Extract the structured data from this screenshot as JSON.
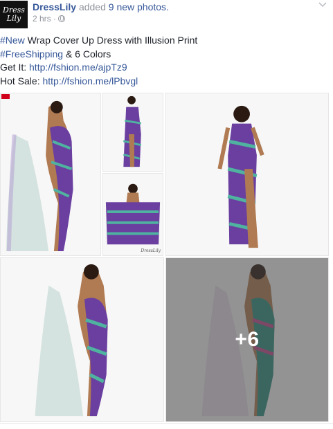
{
  "page": {
    "avatar_text": [
      "Dress",
      "Lily"
    ],
    "name": "DressLily",
    "action_prefix": "added",
    "action_count": "9 new photos.",
    "time": "2 hrs ·"
  },
  "post": {
    "line1_tag": "#New",
    "line1_text": " Wrap Cover Up Dress with Illusion Print",
    "line2_tag": "#FreeShipping",
    "line2_text": " & 6 Colors",
    "line3_label": "Get It: ",
    "line3_link": "http://fshion.me/ajpTz9",
    "line4_label": "Hot Sale: ",
    "line4_link": "http://fshion.me/lPbvgl"
  },
  "photos": {
    "more_count": "+6",
    "watermark": "DressLily"
  },
  "icons": {
    "visibility": "globe-icon",
    "menu": "chevron-down-icon"
  },
  "colors": {
    "link": "#365899",
    "meta": "#90949c",
    "dress_purple": "#6a3fa0",
    "dress_teal": "#4fb3a0",
    "skin": "#b07a52"
  }
}
